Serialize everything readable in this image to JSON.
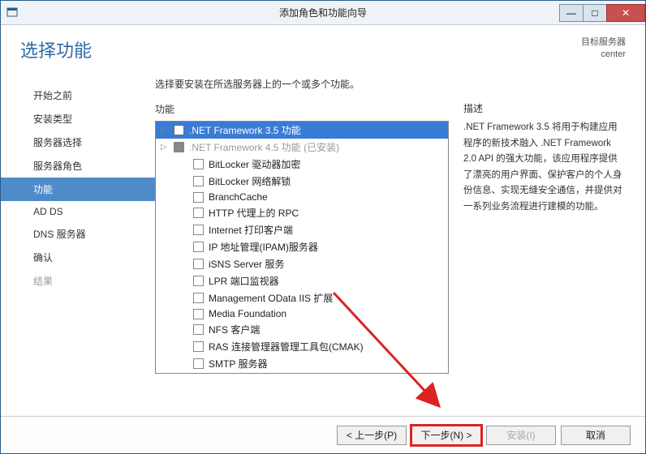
{
  "titlebar": {
    "title": "添加角色和功能向导"
  },
  "header": {
    "page_title": "选择功能",
    "dest_label": "目标服务器",
    "dest_value": "center"
  },
  "sidebar": {
    "items": [
      {
        "label": "开始之前"
      },
      {
        "label": "安装类型"
      },
      {
        "label": "服务器选择"
      },
      {
        "label": "服务器角色"
      },
      {
        "label": "功能",
        "active": true
      },
      {
        "label": "AD DS"
      },
      {
        "label": "DNS 服务器"
      },
      {
        "label": "确认"
      },
      {
        "label": "结果",
        "light": true
      }
    ]
  },
  "main": {
    "instruction": "选择要安装在所选服务器上的一个或多个功能。",
    "features_label": "功能",
    "description_label": "描述",
    "features": [
      {
        "label": ".NET Framework 3.5 功能",
        "expandable": true,
        "selected": true
      },
      {
        "label": ".NET Framework 4.5 功能 (已安装)",
        "expandable": true,
        "dim": true,
        "filled": true
      },
      {
        "label": "BitLocker 驱动器加密",
        "sub": true
      },
      {
        "label": "BitLocker 网络解锁",
        "sub": true
      },
      {
        "label": "BranchCache",
        "sub": true
      },
      {
        "label": "HTTP 代理上的 RPC",
        "sub": true
      },
      {
        "label": "Internet 打印客户端",
        "sub": true
      },
      {
        "label": "IP 地址管理(IPAM)服务器",
        "sub": true
      },
      {
        "label": "iSNS Server 服务",
        "sub": true
      },
      {
        "label": "LPR 端口监视器",
        "sub": true
      },
      {
        "label": "Management OData IIS 扩展",
        "sub": true
      },
      {
        "label": "Media Foundation",
        "sub": true
      },
      {
        "label": "NFS 客户端",
        "sub": true
      },
      {
        "label": "RAS 连接管理器管理工具包(CMAK)",
        "sub": true
      },
      {
        "label": "SMTP 服务器",
        "sub": true
      }
    ],
    "description_text": ".NET Framework 3.5 将用于构建应用程序的新技术融入 .NET Framework 2.0 API 的强大功能，该应用程序提供了漂亮的用户界面、保护客户的个人身份信息、实现无缝安全通信，并提供对一系列业务流程进行建模的功能。"
  },
  "footer": {
    "prev": "< 上一步(P)",
    "next": "下一步(N) >",
    "install": "安装(I)",
    "cancel": "取消"
  }
}
